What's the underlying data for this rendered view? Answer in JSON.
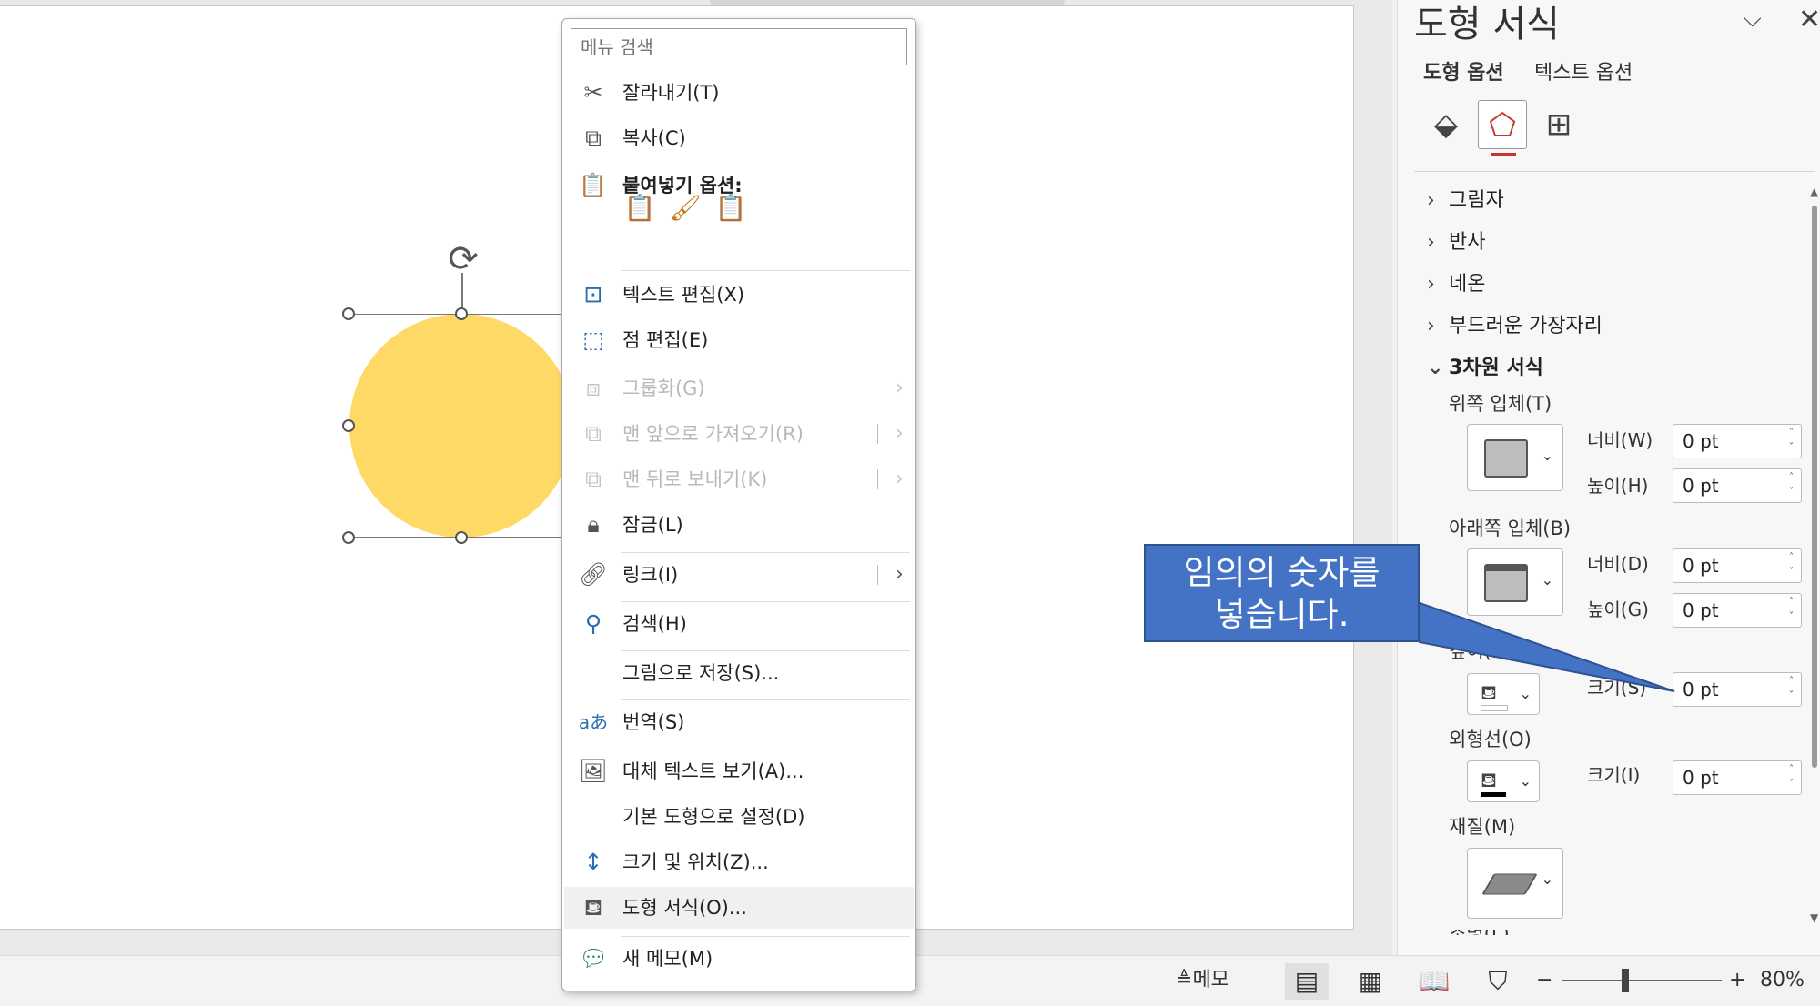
{
  "slide": {
    "shape_fill": "#FFD966"
  },
  "context_menu": {
    "search_placeholder": "메뉴 검색",
    "items": [
      {
        "label": "잘라내기(T)",
        "icon": "scissors-icon"
      },
      {
        "label": "복사(C)",
        "icon": "copy-icon"
      },
      {
        "label": "붙여넣기 옵션:",
        "icon": "paste-icon",
        "paste_options": [
          "paste-keep-source-format-icon",
          "paste-picture-icon",
          "paste-keep-text-only-icon"
        ]
      },
      {
        "label": "텍스트 편집(X)",
        "icon": "edit-text-icon"
      },
      {
        "label": "점 편집(E)",
        "icon": "edit-points-icon"
      },
      {
        "label": "그룹화(G)",
        "icon": "group-icon",
        "disabled": true,
        "submenu": true
      },
      {
        "label": "맨 앞으로 가져오기(R)",
        "icon": "bring-to-front-icon",
        "disabled": true,
        "submenu": true
      },
      {
        "label": "맨 뒤로 보내기(K)",
        "icon": "send-to-back-icon",
        "disabled": true,
        "submenu": true
      },
      {
        "label": "잠금(L)",
        "icon": "lock-icon"
      },
      {
        "label": "링크(I)",
        "icon": "link-icon",
        "submenu": true
      },
      {
        "label": "검색(H)",
        "icon": "search-icon"
      },
      {
        "label": "그림으로 저장(S)...",
        "icon": ""
      },
      {
        "label": "번역(S)",
        "icon": "translate-icon"
      },
      {
        "label": "대체 텍스트 보기(A)...",
        "icon": "alt-text-icon"
      },
      {
        "label": "기본 도형으로 설정(D)",
        "icon": ""
      },
      {
        "label": "크기 및 위치(Z)...",
        "icon": "size-position-icon"
      },
      {
        "label": "도형 서식(O)...",
        "icon": "format-shape-icon"
      },
      {
        "label": "새 메모(M)",
        "icon": "new-comment-icon"
      }
    ]
  },
  "callout": {
    "line1": "임의의 숫자를",
    "line2": "넣습니다."
  },
  "format_pane": {
    "title": "도형 서식",
    "tabs": [
      "도형 옵션",
      "텍스트 옵션"
    ],
    "sections": [
      {
        "label": "그림자",
        "expanded": false
      },
      {
        "label": "반사",
        "expanded": false
      },
      {
        "label": "네온",
        "expanded": false
      },
      {
        "label": "부드러운 가장자리",
        "expanded": false
      },
      {
        "label": "3차원 서식",
        "expanded": true
      }
    ],
    "top_bevel": {
      "label": "위쪽 입체(T)",
      "width_label": "너비(W)",
      "width": "0 pt",
      "height_label": "높이(H)",
      "height": "0 pt"
    },
    "bottom_bevel": {
      "label": "아래쪽 입체(B)",
      "width_label": "너비(D)",
      "width": "0 pt",
      "height_label": "높이(G)",
      "height": "0 pt"
    },
    "depth": {
      "label": "깊이(E)",
      "size_label": "크기(S)",
      "size": "0 pt",
      "color": "#FFFFFF"
    },
    "contour": {
      "label": "외형선(O)",
      "size_label": "크기(I)",
      "size": "0 pt",
      "color": "#000000"
    },
    "material": {
      "label": "재질(M)"
    },
    "next_label": "조명(L)"
  },
  "status_bar": {
    "notes": "메모",
    "zoom": "80%"
  }
}
